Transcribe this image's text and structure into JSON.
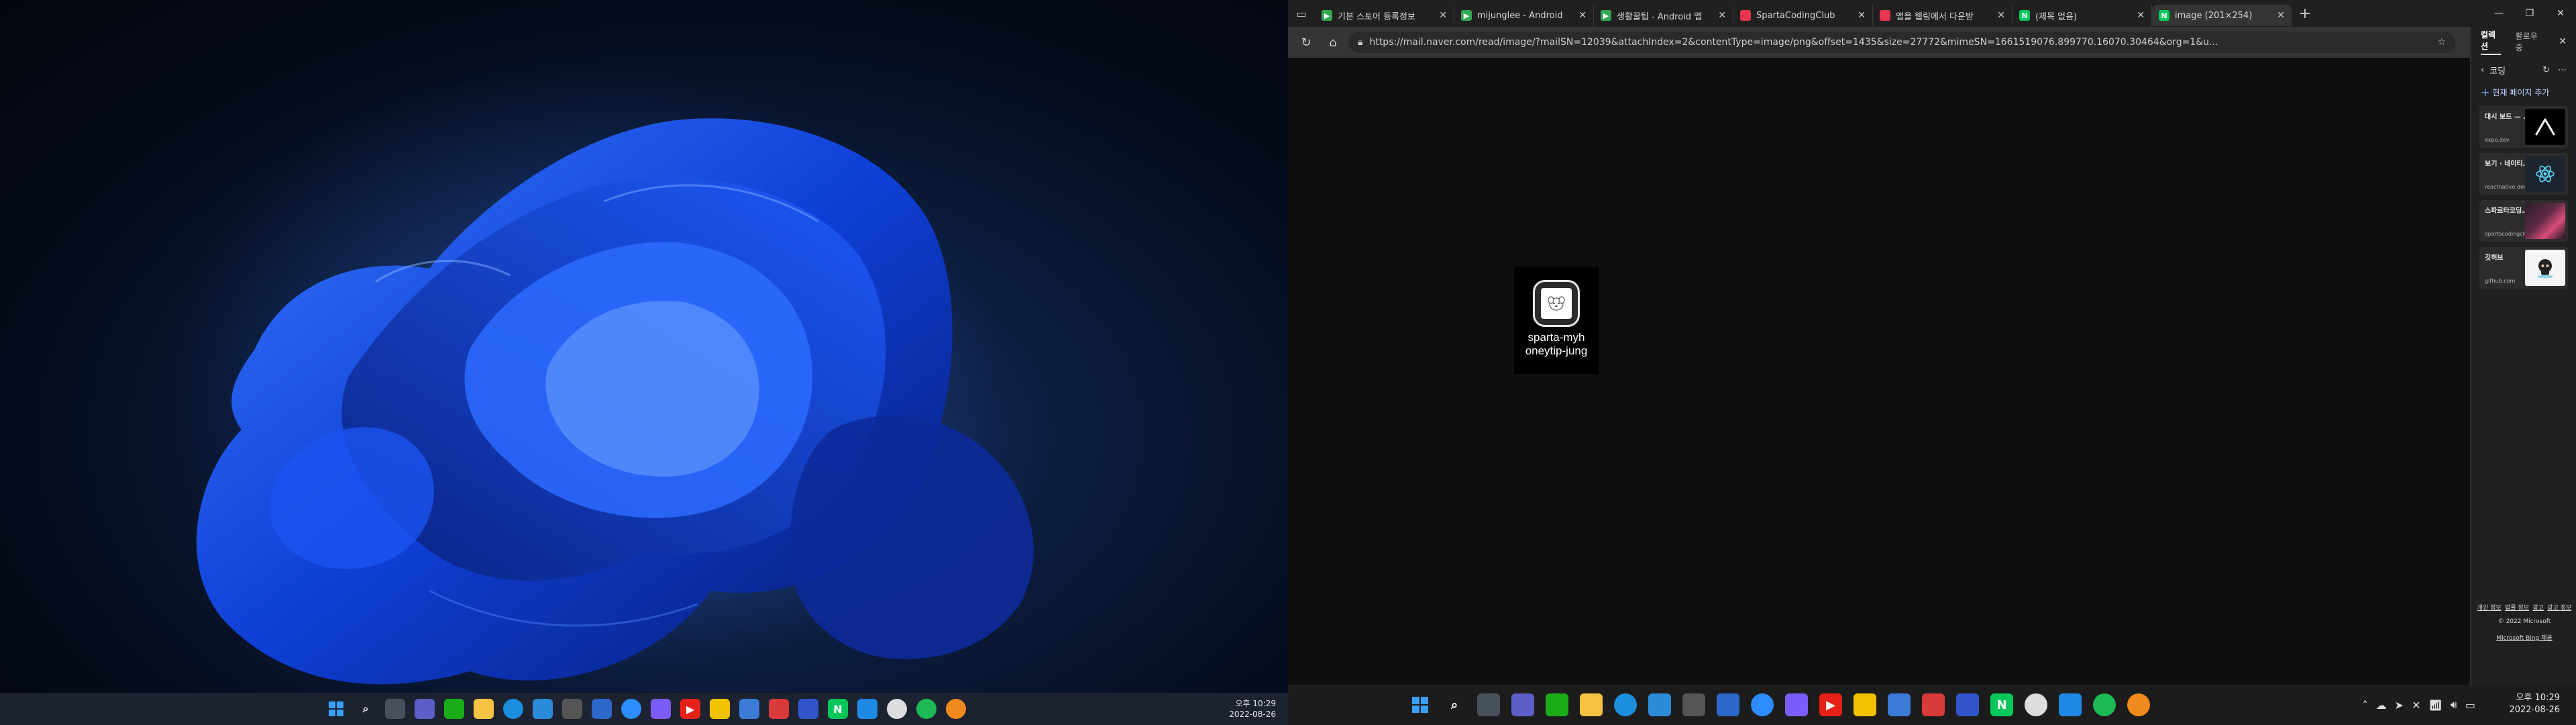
{
  "left_monitor": {
    "taskbar": {
      "icons": [
        "windows-start",
        "search",
        "task-view",
        "chat",
        "file-explorer",
        "edge",
        "store",
        "mail",
        "ms-edge",
        "calculator",
        "photos",
        "youtube",
        "maps",
        "spotify-like",
        "word",
        "settings",
        "naver",
        "vscode",
        "spotify",
        "blender"
      ],
      "clock_time": "오후 10:29",
      "clock_date": "2022-08-26"
    }
  },
  "browser": {
    "tabs": [
      {
        "title": "기본 스토어 등록정보",
        "icon": "google-play-icon",
        "color": "#34a853"
      },
      {
        "title": "mijunglee - Android",
        "icon": "google-play-icon",
        "color": "#34a853"
      },
      {
        "title": "생활꿀팁 - Android 앱",
        "icon": "google-play-icon",
        "color": "#34a853"
      },
      {
        "title": "SpartaCodingClub",
        "icon": "sparta-icon",
        "color": "#e8344e"
      },
      {
        "title": "앱을 웹링에서 다운받",
        "icon": "blog-icon",
        "color": "#e8344e"
      },
      {
        "title": "(제목 없음)",
        "icon": "naver-mail-icon",
        "color": "#03c75a"
      },
      {
        "title": "image (201×254)",
        "icon": "naver-mail-icon",
        "color": "#03c75a"
      }
    ],
    "url": "https://mail.naver.com/read/image/?mailSN=12039&attachIndex=2&contentType=image/png&offset=1435&size=27772&mimeSN=1661519076.899770.16070.30464&org=1&u...",
    "image_viewer": {
      "app_name_line1": "sparta-myh",
      "app_name_line2": "oneytip-jung"
    },
    "collections": {
      "tab_collections": "컬렉션",
      "tab_following": "팔로우 중",
      "current_collection": "코딩",
      "add_current_page": "현재 페이지 추가",
      "items": [
        {
          "title": "대시 보드 — 엑스포",
          "site": "expo.dev",
          "thumb": "expo-logo-icon"
        },
        {
          "title": "보기 · 네이티브 반응",
          "site": "reactnative.dev",
          "thumb": "react-logo-icon"
        },
        {
          "title": "스파르타코딩클럽 - 코딩, ...",
          "site": "spartacodingclub.kr",
          "thumb": "sparta-thumb-icon"
        },
        {
          "title": "깃허브",
          "site": "github.com",
          "thumb": "github-octocat-icon"
        }
      ],
      "footer": {
        "links": [
          "개인 정보",
          "법률 정보",
          "광고",
          "광고 정보"
        ],
        "copyright": "© 2022 Microsoft",
        "bing": "Microsoft Bing 제공"
      }
    }
  },
  "right_monitor": {
    "taskbar": {
      "clock_time": "오후 10:29",
      "clock_date": "2022-08-26"
    }
  }
}
